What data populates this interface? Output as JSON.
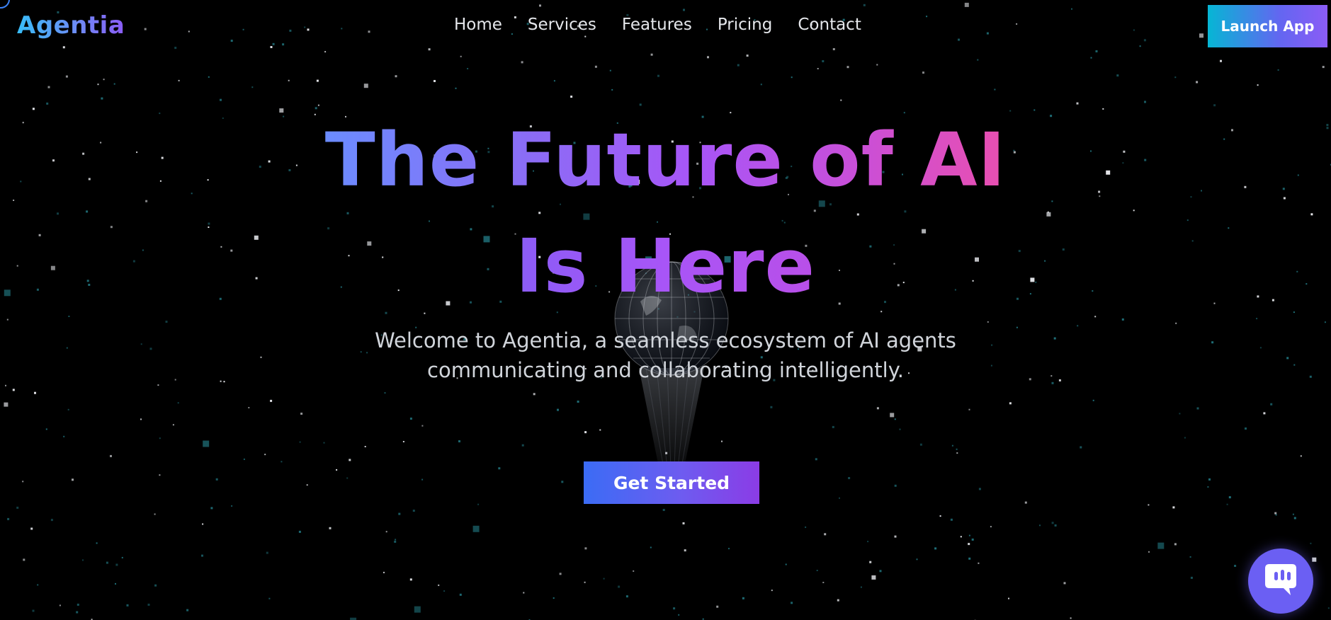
{
  "header": {
    "logo": "Agentia",
    "nav": [
      "Home",
      "Services",
      "Features",
      "Pricing",
      "Contact"
    ],
    "launch_label": "Launch App"
  },
  "hero": {
    "title_line1": "The Future of AI",
    "title_line2": "Is Here",
    "subtitle_line1": "Welcome to Agentia, a seamless ecosystem of AI agents",
    "subtitle_line2": "communicating and collaborating intelligently.",
    "cta_label": "Get Started"
  },
  "chat": {
    "icon": "chat-bubble-icon"
  },
  "colors": {
    "background": "#000000",
    "accent_blue": "#3b82f6",
    "accent_purple": "#8b5cf6",
    "accent_pink": "#e94fb0",
    "chat": "#6b5ff3"
  }
}
